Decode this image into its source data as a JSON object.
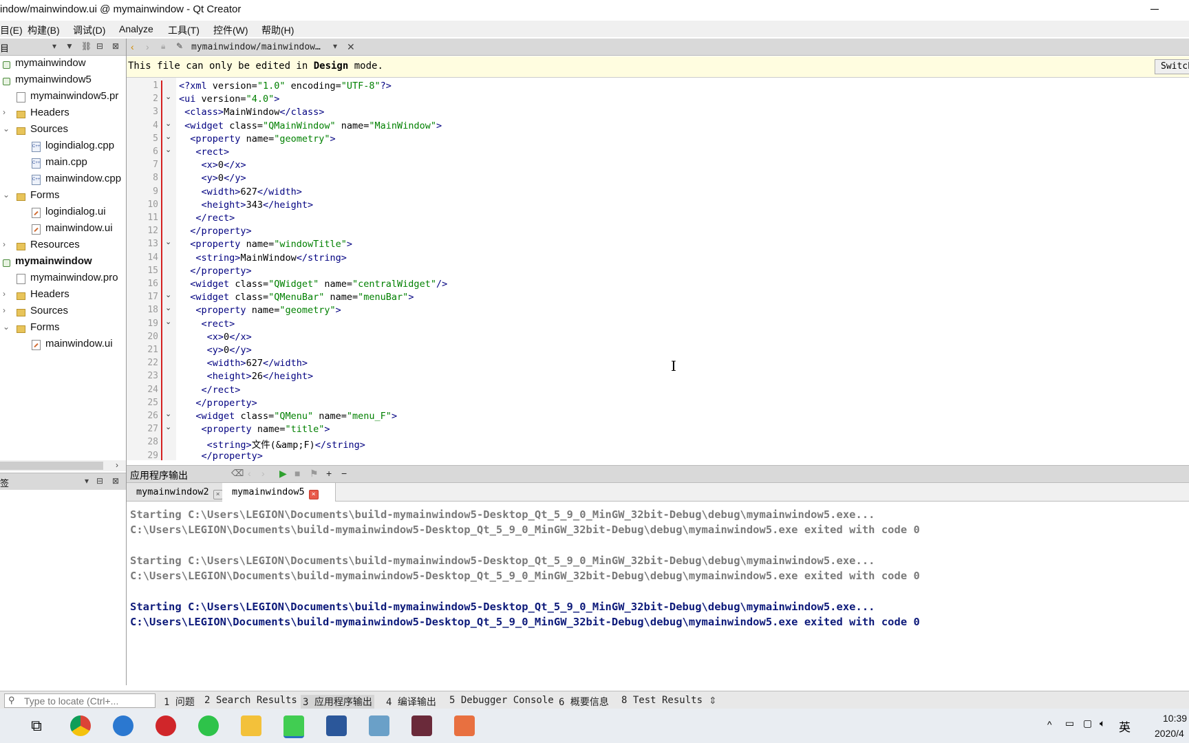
{
  "window": {
    "title": "indow/mainwindow.ui @ mymainwindow - Qt Creator"
  },
  "menubar": [
    "目(E)",
    "构建(B)",
    "调试(D)",
    "Analyze",
    "工具(T)",
    "控件(W)",
    "帮助(H)"
  ],
  "left_panel": {
    "toolbar_title": "目",
    "tree": [
      {
        "label": "mymainwindow",
        "indent": 0,
        "arrow": "",
        "icon": "proj-icon",
        "bold": false
      },
      {
        "label": "mymainwindow5",
        "indent": 0,
        "arrow": "",
        "icon": "proj-icon",
        "bold": false
      },
      {
        "label": "mymainwindow5.pr",
        "indent": 2,
        "arrow": "",
        "icon": "pro-file-icon",
        "bold": false
      },
      {
        "label": "Headers",
        "indent": 1,
        "arrow": "›",
        "icon": "headers-folder-icon",
        "bold": false
      },
      {
        "label": "Sources",
        "indent": 1,
        "arrow": "⌄",
        "icon": "sources-folder-icon",
        "bold": false
      },
      {
        "label": "logindialog.cpp",
        "indent": 3,
        "arrow": "",
        "icon": "cpp-file-icon",
        "bold": false
      },
      {
        "label": "main.cpp",
        "indent": 3,
        "arrow": "",
        "icon": "cpp-file-icon",
        "bold": false
      },
      {
        "label": "mainwindow.cpp",
        "indent": 3,
        "arrow": "",
        "icon": "cpp-file-icon",
        "bold": false
      },
      {
        "label": "Forms",
        "indent": 1,
        "arrow": "⌄",
        "icon": "forms-folder-icon",
        "bold": false
      },
      {
        "label": "logindialog.ui",
        "indent": 3,
        "arrow": "",
        "icon": "ui-file-icon",
        "bold": false
      },
      {
        "label": "mainwindow.ui",
        "indent": 3,
        "arrow": "",
        "icon": "ui-file-icon",
        "bold": false
      },
      {
        "label": "Resources",
        "indent": 1,
        "arrow": "›",
        "icon": "resources-folder-icon",
        "bold": false
      },
      {
        "label": "mymainwindow",
        "indent": 0,
        "arrow": "",
        "icon": "proj-icon",
        "bold": true
      },
      {
        "label": "mymainwindow.pro",
        "indent": 2,
        "arrow": "",
        "icon": "pro-file-icon",
        "bold": false
      },
      {
        "label": "Headers",
        "indent": 1,
        "arrow": "›",
        "icon": "headers-folder-icon",
        "bold": false
      },
      {
        "label": "Sources",
        "indent": 1,
        "arrow": "›",
        "icon": "sources-folder-icon",
        "bold": false
      },
      {
        "label": "Forms",
        "indent": 1,
        "arrow": "⌄",
        "icon": "forms-folder-icon",
        "bold": false
      },
      {
        "label": "mainwindow.ui",
        "indent": 3,
        "arrow": "",
        "icon": "ui-file-icon",
        "bold": false
      }
    ],
    "open_docs_title": "签"
  },
  "editor": {
    "file_tab": "mymainwindow/mainwindow…",
    "info_prefix": "This file can only be edited in ",
    "info_bold": "Design",
    "info_suffix": " mode.",
    "switch_button": "Switch",
    "lines": [
      {
        "n": "1",
        "fold": "",
        "text": "<?xml version=\"1.0\" encoding=\"UTF-8\"?>"
      },
      {
        "n": "2",
        "fold": "⌄",
        "text": "<ui version=\"4.0\">"
      },
      {
        "n": "3",
        "fold": "",
        "text": " <class>MainWindow</class>"
      },
      {
        "n": "4",
        "fold": "⌄",
        "text": " <widget class=\"QMainWindow\" name=\"MainWindow\">"
      },
      {
        "n": "5",
        "fold": "⌄",
        "text": "  <property name=\"geometry\">"
      },
      {
        "n": "6",
        "fold": "⌄",
        "text": "   <rect>"
      },
      {
        "n": "7",
        "fold": "",
        "text": "    <x>0</x>"
      },
      {
        "n": "8",
        "fold": "",
        "text": "    <y>0</y>"
      },
      {
        "n": "9",
        "fold": "",
        "text": "    <width>627</width>"
      },
      {
        "n": "10",
        "fold": "",
        "text": "    <height>343</height>"
      },
      {
        "n": "11",
        "fold": "",
        "text": "   </rect>"
      },
      {
        "n": "12",
        "fold": "",
        "text": "  </property>"
      },
      {
        "n": "13",
        "fold": "⌄",
        "text": "  <property name=\"windowTitle\">"
      },
      {
        "n": "14",
        "fold": "",
        "text": "   <string>MainWindow</string>"
      },
      {
        "n": "15",
        "fold": "",
        "text": "  </property>"
      },
      {
        "n": "16",
        "fold": "",
        "text": "  <widget class=\"QWidget\" name=\"centralWidget\"/>"
      },
      {
        "n": "17",
        "fold": "⌄",
        "text": "  <widget class=\"QMenuBar\" name=\"menuBar\">"
      },
      {
        "n": "18",
        "fold": "⌄",
        "text": "   <property name=\"geometry\">"
      },
      {
        "n": "19",
        "fold": "⌄",
        "text": "    <rect>"
      },
      {
        "n": "20",
        "fold": "",
        "text": "     <x>0</x>"
      },
      {
        "n": "21",
        "fold": "",
        "text": "     <y>0</y>"
      },
      {
        "n": "22",
        "fold": "",
        "text": "     <width>627</width>"
      },
      {
        "n": "23",
        "fold": "",
        "text": "     <height>26</height>"
      },
      {
        "n": "24",
        "fold": "",
        "text": "    </rect>"
      },
      {
        "n": "25",
        "fold": "",
        "text": "   </property>"
      },
      {
        "n": "26",
        "fold": "⌄",
        "text": "   <widget class=\"QMenu\" name=\"menu_F\">"
      },
      {
        "n": "27",
        "fold": "⌄",
        "text": "    <property name=\"title\">"
      },
      {
        "n": "28",
        "fold": "",
        "text": "     <string>文件(&amp;F)</string>"
      },
      {
        "n": "29",
        "fold": "",
        "text": "    </property>"
      }
    ]
  },
  "output": {
    "title": "应用程序输出",
    "tabs": [
      {
        "label": "mymainwindow2",
        "active": false
      },
      {
        "label": "mymainwindow5",
        "active": true
      }
    ],
    "lines": [
      {
        "text": "Starting C:\\Users\\LEGION\\Documents\\build-mymainwindow5-Desktop_Qt_5_9_0_MinGW_32bit-Debug\\debug\\mymainwindow5.exe...",
        "state": "old"
      },
      {
        "text": "C:\\Users\\LEGION\\Documents\\build-mymainwindow5-Desktop_Qt_5_9_0_MinGW_32bit-Debug\\debug\\mymainwindow5.exe exited with code 0",
        "state": "old"
      },
      {
        "text": "",
        "state": "old"
      },
      {
        "text": "Starting C:\\Users\\LEGION\\Documents\\build-mymainwindow5-Desktop_Qt_5_9_0_MinGW_32bit-Debug\\debug\\mymainwindow5.exe...",
        "state": "old"
      },
      {
        "text": "C:\\Users\\LEGION\\Documents\\build-mymainwindow5-Desktop_Qt_5_9_0_MinGW_32bit-Debug\\debug\\mymainwindow5.exe exited with code 0",
        "state": "old"
      },
      {
        "text": "",
        "state": "old"
      },
      {
        "text": "Starting C:\\Users\\LEGION\\Documents\\build-mymainwindow5-Desktop_Qt_5_9_0_MinGW_32bit-Debug\\debug\\mymainwindow5.exe...",
        "state": "new"
      },
      {
        "text": "C:\\Users\\LEGION\\Documents\\build-mymainwindow5-Desktop_Qt_5_9_0_MinGW_32bit-Debug\\debug\\mymainwindow5.exe exited with code 0",
        "state": "new"
      }
    ]
  },
  "bottombar": {
    "locate_placeholder": "Type to locate (Ctrl+...",
    "panes": [
      "1 问题",
      "2 Search Results",
      "3 应用程序输出",
      "4 编译输出",
      "5 Debugger Console",
      "6 概要信息",
      "8 Test Results"
    ]
  },
  "taskbar": {
    "apps": [
      "task-view-icon",
      "chrome-icon",
      "clock-app-icon",
      "netease-music-icon",
      "wechat-icon",
      "file-explorer-icon",
      "qt-creator-icon",
      "word-icon",
      "notes-icon",
      "video-editor-icon",
      "paint-icon"
    ],
    "ime": "英",
    "time": "10:39",
    "date": "2020/4"
  }
}
